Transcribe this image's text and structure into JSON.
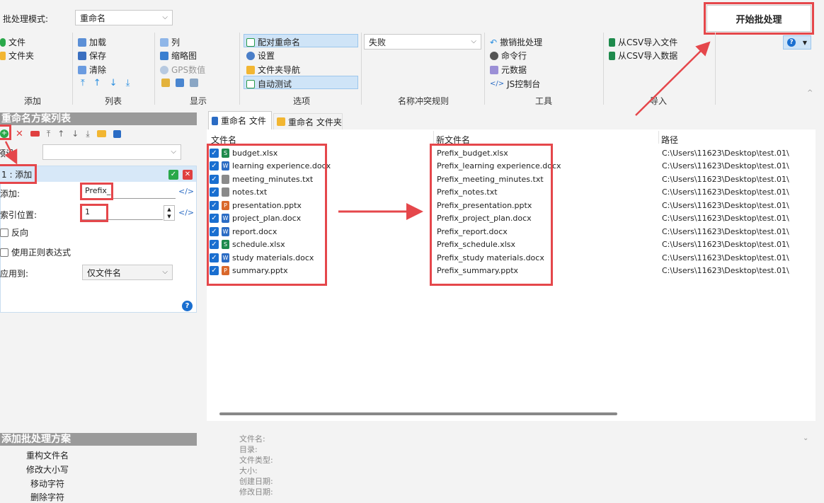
{
  "top": {
    "mode_label": "批处理模式:",
    "mode_value": "重命名",
    "start_button": "开始批处理"
  },
  "ribbon": {
    "add_group": {
      "file": "文件",
      "folder": "文件夹",
      "caption": "添加"
    },
    "list_group": {
      "load": "加载",
      "save": "保存",
      "clear": "清除",
      "caption": "列表"
    },
    "display_group": {
      "columns": "列",
      "thumbnails": "缩略图",
      "gps": "GPS数值",
      "caption": "显示"
    },
    "options_group": {
      "pair_rename": "配对重命名",
      "settings": "设置",
      "folder_nav": "文件夹导航",
      "auto_test": "自动测试",
      "caption": "选项"
    },
    "conflict_group": {
      "value": "失败",
      "caption": "名称冲突规则"
    },
    "tools_group": {
      "undo": "撤销批处理",
      "cmdline": "命令行",
      "metadata": "元数据",
      "js_console": "JS控制台",
      "caption": "工具"
    },
    "import_group": {
      "csv_file": "从CSV导入文件",
      "csv_data": "从CSV导入数据",
      "caption": "导入"
    }
  },
  "left": {
    "plan_list_title": "重命名方案列表",
    "preset_label": "预设",
    "rule_title": "1 : 添加",
    "add_label": "添加:",
    "add_value": "Prefix_",
    "index_label": "索引位置:",
    "index_value": "1",
    "reverse_label": "反向",
    "regex_label": "使用正则表达式",
    "apply_label": "应用到:",
    "apply_value": "仅文件名",
    "add_plan_title": "添加批处理方案",
    "plans": [
      "重构文件名",
      "修改大小写",
      "移动字符",
      "删除字符"
    ]
  },
  "tabs": [
    "重命名 文件",
    "重命名 文件夹"
  ],
  "table": {
    "headers": [
      "文件名",
      "新文件名",
      "路径"
    ],
    "rows": [
      {
        "name": "budget.xlsx",
        "new": "Prefix_budget.xlsx",
        "path": "C:\\Users\\11623\\Desktop\\test.01\\",
        "type": "xlsx"
      },
      {
        "name": "learning experience.docx",
        "new": "Prefix_learning experience.docx",
        "path": "C:\\Users\\11623\\Desktop\\test.01\\",
        "type": "docx"
      },
      {
        "name": "meeting_minutes.txt",
        "new": "Prefix_meeting_minutes.txt",
        "path": "C:\\Users\\11623\\Desktop\\test.01\\",
        "type": "txt"
      },
      {
        "name": "notes.txt",
        "new": "Prefix_notes.txt",
        "path": "C:\\Users\\11623\\Desktop\\test.01\\",
        "type": "txt"
      },
      {
        "name": "presentation.pptx",
        "new": "Prefix_presentation.pptx",
        "path": "C:\\Users\\11623\\Desktop\\test.01\\",
        "type": "pptx"
      },
      {
        "name": "project_plan.docx",
        "new": "Prefix_project_plan.docx",
        "path": "C:\\Users\\11623\\Desktop\\test.01\\",
        "type": "docx"
      },
      {
        "name": "report.docx",
        "new": "Prefix_report.docx",
        "path": "C:\\Users\\11623\\Desktop\\test.01\\",
        "type": "docx"
      },
      {
        "name": "schedule.xlsx",
        "new": "Prefix_schedule.xlsx",
        "path": "C:\\Users\\11623\\Desktop\\test.01\\",
        "type": "xlsx"
      },
      {
        "name": "study materials.docx",
        "new": "Prefix_study materials.docx",
        "path": "C:\\Users\\11623\\Desktop\\test.01\\",
        "type": "docx"
      },
      {
        "name": "summary.pptx",
        "new": "Prefix_summary.pptx",
        "path": "C:\\Users\\11623\\Desktop\\test.01\\",
        "type": "pptx"
      }
    ]
  },
  "details": [
    "文件名:",
    "目录:",
    "文件类型:",
    "大小:",
    "创建日期:",
    "修改日期:"
  ],
  "colors": {
    "accent": "#1a6fd0",
    "red": "#e5474b",
    "xlsx": "#1e8a4c",
    "docx": "#2b6cc4",
    "pptx": "#d9682b",
    "txt": "#8a8a8a"
  }
}
